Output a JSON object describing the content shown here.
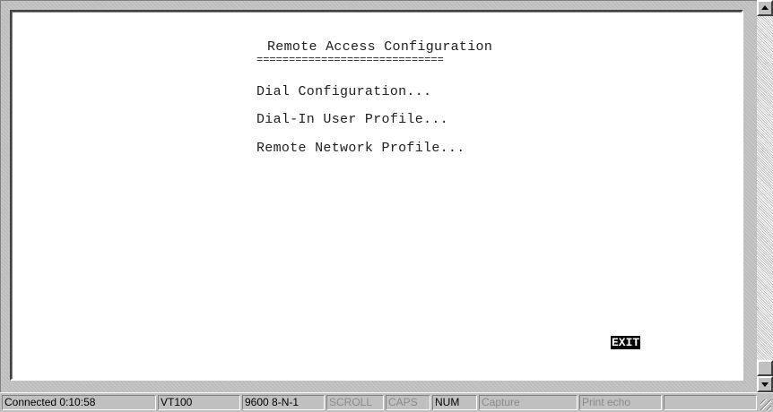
{
  "terminal": {
    "title": "Remote Access Configuration",
    "title_underline": "=============================",
    "menu_items": [
      "Dial Configuration...",
      "Dial-In User Profile...",
      "Remote Network Profile..."
    ],
    "exit_label": "EXIT"
  },
  "statusbar": {
    "connected": "Connected 0:10:58",
    "emulation": "VT100",
    "port_settings": "9600 8-N-1",
    "scroll": "SCROLL",
    "caps": "CAPS",
    "num": "NUM",
    "capture": "Capture",
    "print_echo": "Print echo"
  },
  "icons": {
    "scroll_up": "triangle-up-icon",
    "scroll_down": "triangle-down-icon",
    "resize_grip": "resize-grip-icon"
  }
}
